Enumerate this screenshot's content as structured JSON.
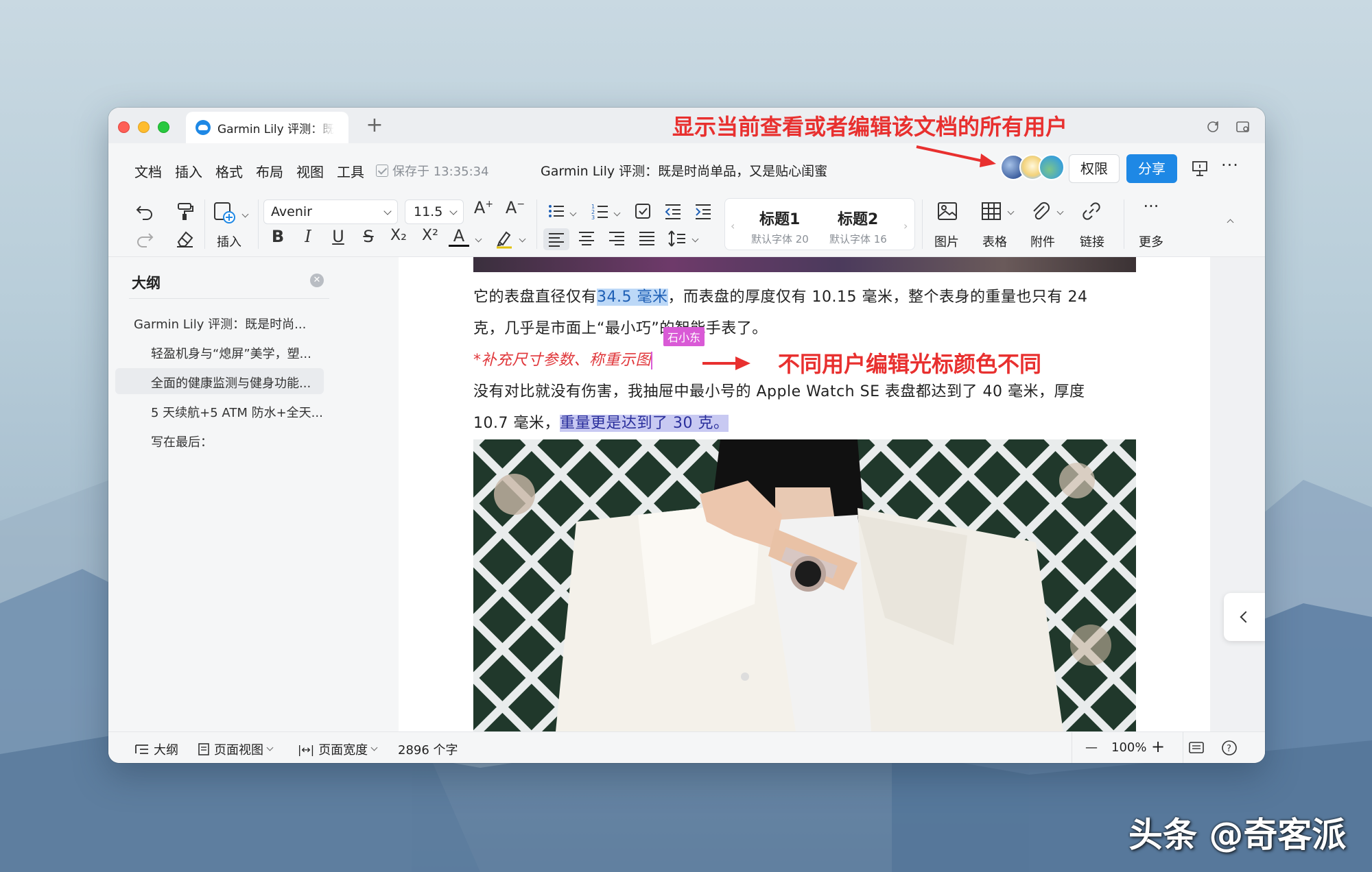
{
  "window": {
    "tab_title": "Garmin Lily 评测：既是时尚单品，又是贴心闺蜜",
    "tab_add": "+"
  },
  "menubar": {
    "items": [
      "文档",
      "插入",
      "格式",
      "布局",
      "视图",
      "工具"
    ],
    "saved_status": "保存于 13:35:34",
    "doc_title": "Garmin Lily 评测：既是时尚单品，又是贴心闺蜜",
    "permission_label": "权限",
    "share_label": "分享",
    "more": "···"
  },
  "toolbar": {
    "insert_label": "插入",
    "font": "Avenir",
    "font_size": "11.5",
    "styles": [
      {
        "name": "标题1",
        "sub": "默认字体 20"
      },
      {
        "name": "标题2",
        "sub": "默认字体 16"
      }
    ],
    "tools": [
      "图片",
      "表格",
      "附件",
      "链接"
    ],
    "more_label": "更多",
    "bold": "B",
    "italic": "I",
    "underline": "U",
    "strike": "S",
    "subscript": "X₂",
    "superscript": "X²",
    "font_color": "A"
  },
  "outline": {
    "title": "大纲",
    "items": [
      {
        "label": "Garmin Lily 评测：既是时尚...",
        "level": 1
      },
      {
        "label": "轻盈机身与“熄屏”美学，塑...",
        "level": 2
      },
      {
        "label": "全面的健康监测与健身功能...",
        "level": 2,
        "active": true
      },
      {
        "label": "5 天续航+5 ATM 防水+全天...",
        "level": 2
      },
      {
        "label": "写在最后：",
        "level": 2
      }
    ]
  },
  "document": {
    "para1_a": "它的表盘直径仅有",
    "para1_hl": "34.5 毫米",
    "para1_b": "，而表盘的厚度仅有 10.15 毫米，整个表身的重量也只有 24",
    "para2": "克，几乎是市面上“最小巧”的智能手表了。",
    "remark": "*补充尺寸参数、称重示图",
    "cursor_user": "石小东",
    "para3": "没有对比就没有伤害，我抽屉中最小号的 Apple Watch SE 表盘都达到了 40 毫米，厚度",
    "para4_a": "10.7 毫米，",
    "para4_hl": "重量更是达到了 30 克。"
  },
  "statusbar": {
    "outline": "大纲",
    "page_view": "页面视图",
    "page_width": "页面宽度",
    "word_count": "2896 个字",
    "zoom": "100%",
    "minus": "—",
    "plus": "+"
  },
  "annotations": {
    "top": "显示当前查看或者编辑该文档的所有用户",
    "middle": "不同用户编辑光标颜色不同"
  },
  "watermark": "头条 @奇客派",
  "colors": {
    "accent": "#1e88e5",
    "annotation": "#e8302f",
    "cursor": "#d95ad6",
    "highlight_blue": "#bcd8f7",
    "highlight_purple": "#c8c9f2"
  }
}
